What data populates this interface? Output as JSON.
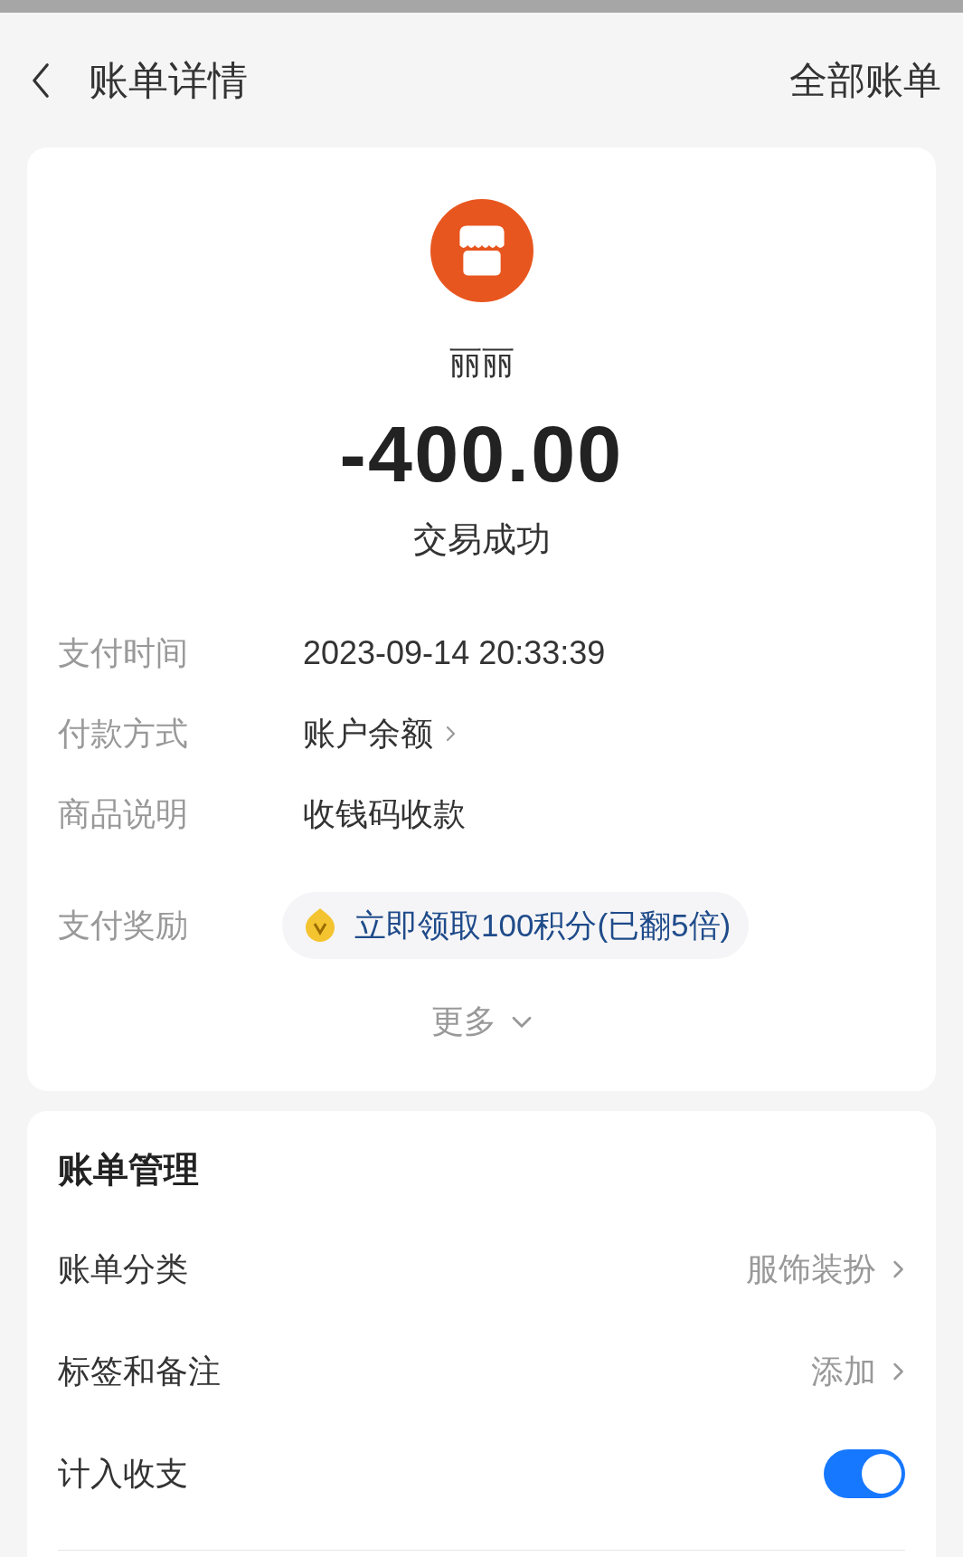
{
  "header": {
    "title": "账单详情",
    "action": "全部账单"
  },
  "merchant": {
    "name": "丽丽",
    "amount": "-400.00",
    "status": "交易成功"
  },
  "details": [
    {
      "kind": "text",
      "label": "支付时间",
      "value": "2023-09-14 20:33:39"
    },
    {
      "kind": "link",
      "label": "付款方式",
      "value": "账户余额"
    },
    {
      "kind": "text",
      "label": "商品说明",
      "value": "收钱码收款"
    },
    {
      "kind": "reward",
      "label": "支付奖励",
      "value": "立即领取100积分(已翻5倍)"
    }
  ],
  "more": "更多",
  "management": {
    "title": "账单管理",
    "rows": [
      {
        "kind": "link",
        "label": "账单分类",
        "value": "服饰装扮"
      },
      {
        "kind": "link",
        "label": "标签和备注",
        "value": "添加"
      },
      {
        "kind": "toggle",
        "label": "计入收支",
        "on": true
      }
    ]
  }
}
